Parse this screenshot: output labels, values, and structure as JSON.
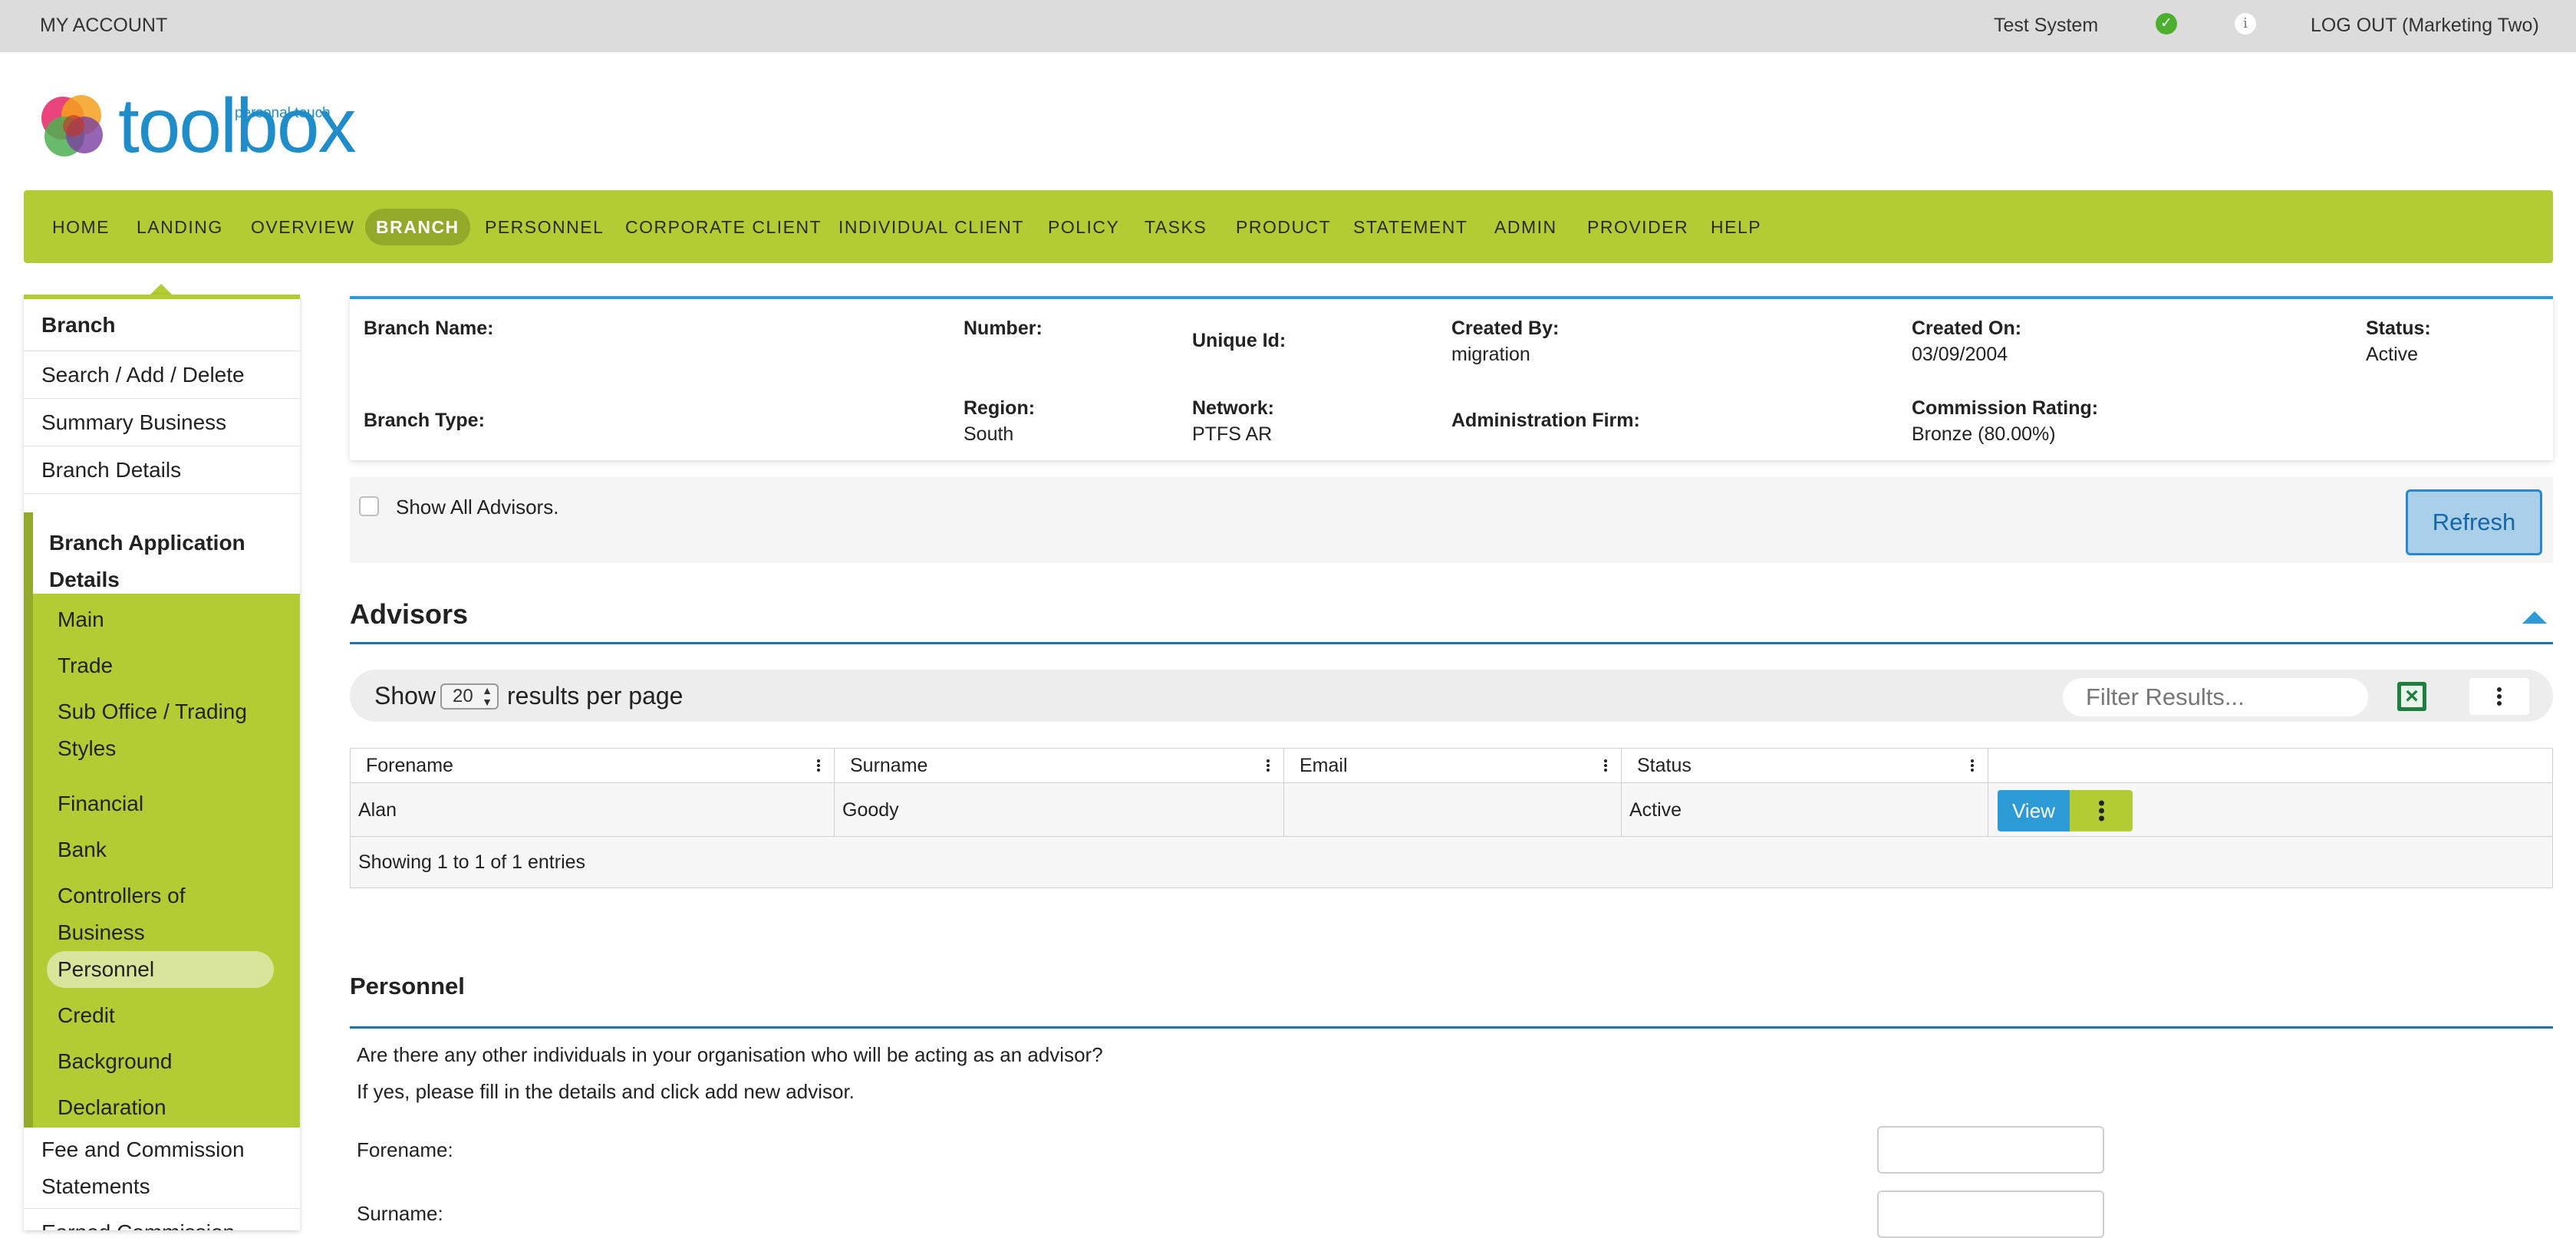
{
  "topbar": {
    "my_account": "MY ACCOUNT",
    "system": "Test System",
    "status_icon": "check-circle-icon",
    "info_icon": "info-icon",
    "logout": "LOG OUT (Marketing Two)"
  },
  "logo": {
    "word": "toolbox",
    "tagline": "personal touch"
  },
  "nav": {
    "items": [
      "HOME",
      "LANDING",
      "OVERVIEW",
      "BRANCH",
      "PERSONNEL",
      "CORPORATE CLIENT",
      "INDIVIDUAL CLIENT",
      "POLICY",
      "TASKS",
      "PRODUCT",
      "STATEMENT",
      "ADMIN",
      "PROVIDER",
      "HELP"
    ],
    "active": "BRANCH"
  },
  "sidebar": {
    "title": "Branch",
    "items": [
      "Search / Add / Delete",
      "Summary Business",
      "Branch Details"
    ],
    "app_group": "Branch Application Details",
    "sub_items": [
      "Main",
      "Trade",
      "Sub Office / Trading Styles",
      "Financial",
      "Bank",
      "Controllers of Business",
      "Personnel",
      "Credit",
      "Background",
      "Declaration"
    ],
    "active_sub": "Personnel",
    "after_items": [
      "Fee and Commission Statements",
      "Earned Commission"
    ]
  },
  "branch_info": {
    "branch_name_label": "Branch Name:",
    "number_label": "Number:",
    "unique_id_label": "Unique Id:",
    "created_by_label": "Created By:",
    "created_by": "migration",
    "created_on_label": "Created On:",
    "created_on": "03/09/2004",
    "status_label": "Status:",
    "status": "Active",
    "branch_type_label": "Branch Type:",
    "region_label": "Region:",
    "region": "South",
    "network_label": "Network:",
    "network": "PTFS AR",
    "admin_firm_label": "Administration Firm:",
    "commission_rating_label": "Commission Rating:",
    "commission_rating": "Bronze (80.00%)"
  },
  "show_all": {
    "label": "Show All Advisors.",
    "checked": false
  },
  "refresh_label": "Refresh",
  "advisors": {
    "title": "Advisors",
    "show_label": "Show",
    "page_size": "20",
    "per_page_label": "results per page",
    "filter_placeholder": "Filter Results...",
    "export_icon": "excel-icon",
    "columns": [
      "Forename",
      "Surname",
      "Email",
      "Status"
    ],
    "rows": [
      {
        "forename": "Alan",
        "surname": "Goody",
        "email": "",
        "status": "Active"
      }
    ],
    "view_label": "View",
    "footer": "Showing 1 to 1 of 1 entries"
  },
  "personnel": {
    "title": "Personnel",
    "question": "Are there any other individuals in your organisation who will be acting as an advisor?",
    "instruction": "If yes, please fill in the details and click add new advisor.",
    "forename_label": "Forename:",
    "surname_label": "Surname:",
    "forename_value": "",
    "surname_value": ""
  }
}
